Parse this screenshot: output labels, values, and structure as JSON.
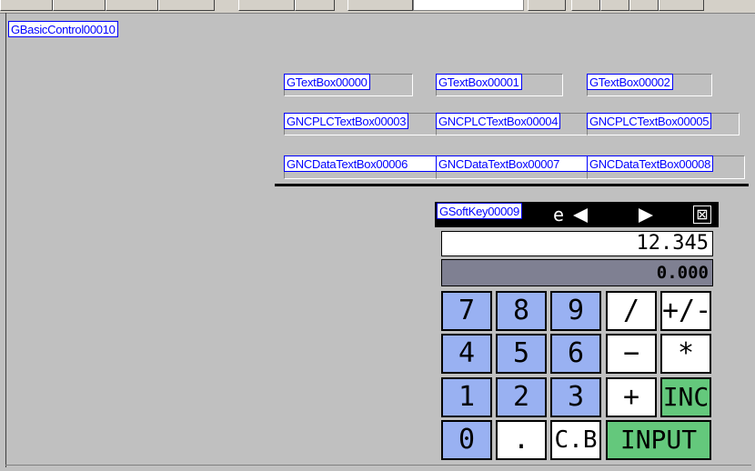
{
  "controls": {
    "basic": "GBasicControl00010",
    "textboxes": [
      "GTextBox00000",
      "GTextBox00001",
      "GTextBox00002"
    ],
    "plc_textboxes": [
      "GNCPLCTextBox00003",
      "GNCPLCTextBox00004",
      "GNCPLCTextBox00005"
    ],
    "data_textboxes": [
      "GNCDataTextBox00006",
      "GNCDataTextBox00007",
      "GNCDataTextBox00008"
    ],
    "softkey": "GSoftKey00009"
  },
  "calculator": {
    "title_fragment": "e",
    "close_symbol": "⊠",
    "value": "12.345",
    "sub_value": "0.000",
    "keys": {
      "k7": "7",
      "k8": "8",
      "k9": "9",
      "div": "/",
      "sign": "+/-",
      "k4": "4",
      "k5": "5",
      "k6": "6",
      "minus": "−",
      "mul": "*",
      "k1": "1",
      "k2": "2",
      "k3": "3",
      "plus": "+",
      "inc": "INC",
      "k0": "0",
      "dot": ".",
      "cb": "C.B",
      "input": "INPUT"
    }
  },
  "colors": {
    "background": "#c0c0c0",
    "control_label": "#0000ff",
    "num_key": "#99b1f2",
    "green_key": "#64c87c",
    "sub_display": "#7f8092"
  }
}
